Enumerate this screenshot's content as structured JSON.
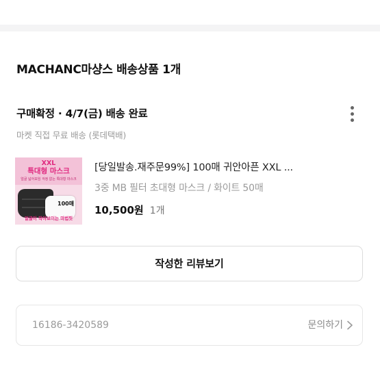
{
  "order": {
    "shop_title": "MACHANC마샹스 배송상품 1개",
    "status": "구매확정 · 4/7(금) 배송 완료",
    "shipping_note": "마켓 직접 무료 배송 (롯데택배)",
    "more_icon": "more-vertical-icon"
  },
  "product": {
    "name": "[당일발송.재주문99%] 100매 귀안아픈 XXL ...",
    "option": "3중 MB 필터 초대형 마스크 / 화이트 50매",
    "price": "10,500원",
    "quantity": "1개",
    "thumbnail": {
      "line1": "XXL",
      "line2": "특대형 마스크",
      "line3": "얼굴 넓어보임 걱정 없는 특대형 마스크",
      "qty_label": "100매",
      "bottom_text": "얼굴이 작아보이는 마법핏",
      "accent_color": "#e0287f"
    }
  },
  "actions": {
    "review_button": "작성한 리뷰보기"
  },
  "footer_box": {
    "order_number": "16186-3420589",
    "inquiry_label": "문의하기",
    "chevron_icon": "chevron-right-icon"
  }
}
